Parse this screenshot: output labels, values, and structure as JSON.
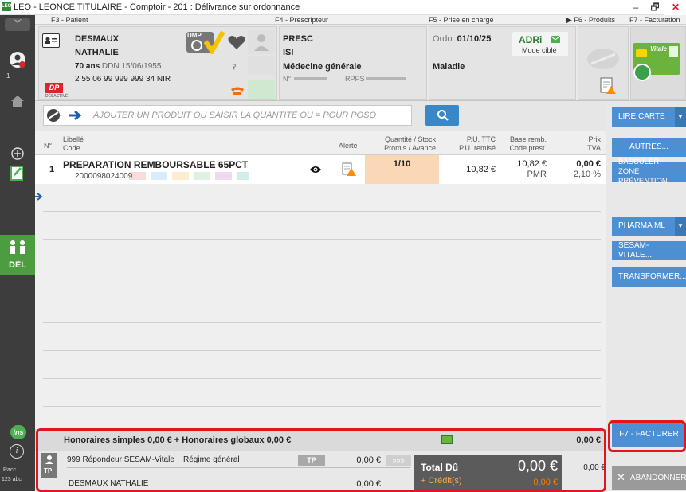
{
  "window": {
    "title": "LEO - LEONCE TITULAIRE - Comptoir - 201 : Délivrance sur ordonnance",
    "logo": "LEO",
    "controls": [
      "–",
      "🗗",
      "✕"
    ]
  },
  "fkeys": {
    "patient": "F3 - Patient",
    "prescripteur": "F4 - Prescripteur",
    "prise_en_charge": "F5 - Prise en charge",
    "produits": "▶ F6 - Produits",
    "facturation": "F7 - Facturation"
  },
  "leftbar": {
    "badge": "1",
    "del_label": "DÉL",
    "ins_label": "ins",
    "racc_label": "Racc.",
    "abc_label": "123 abc"
  },
  "patient": {
    "lastname": "DESMAUX",
    "firstname": "NATHALIE",
    "age": "70 ans",
    "ddn": "DDN 15/06/1955",
    "nir": "2 55 06 99 999 999 34 NIR",
    "gender_symbol": "♀",
    "dmp_label": "DMP",
    "dp_label": "DP",
    "dp_sub": "DÉSACTIVÉ"
  },
  "prescripteur": {
    "line1": "PRESC",
    "line2": "ISI",
    "specialty": "Médecine générale",
    "n_label": "N°",
    "rpps_label": "RPPS"
  },
  "ordonnance": {
    "ordo_label": "Ordo.",
    "ordo_date": "01/10/25",
    "adri_label": "ADRi",
    "mode": "Mode ciblé",
    "nature": "Maladie"
  },
  "vitale": {
    "label": "Vitale"
  },
  "search": {
    "placeholder": "AJOUTER UN PRODUIT OU SAISIR LA QUANTITÉ OU = POUR POSO"
  },
  "table": {
    "headers": {
      "num": "N°",
      "libelle": "Libellé",
      "code": "Code",
      "alerte": "Alerte",
      "qty": "Quantité / Stock",
      "promis": "Promis / Avance",
      "pu": "P.U. TTC",
      "pu_remise": "P.U. remisé",
      "base": "Base remb.",
      "code_prest": "Code prest.",
      "prix": "Prix",
      "tva": "TVA"
    },
    "rows": [
      {
        "num": "1",
        "libelle": "PREPARATION REMBOURSABLE 65PCT",
        "code": "2000098024009",
        "qty": "1/10",
        "pu": "10,82 €",
        "base": "10,82 €",
        "prest": "PMR",
        "prix": "0,00 €",
        "tva": "2,10 %"
      }
    ]
  },
  "rightbar": {
    "lire_carte": "LIRE CARTE",
    "autres": "AUTRES...",
    "basculer": "BASCULER ZONE PRÉVENTION",
    "pharma_ml": "PHARMA ML",
    "sesam": "SESAM-VITALE...",
    "transformer": "TRANSFORMER...",
    "facturer": "F7 - FACTURER",
    "abandonner": "ABANDONNER"
  },
  "bottom": {
    "honoraires": "Honoraires simples 0,00 € + Honoraires globaux 0,00 €",
    "honoraires_total": "0,00 €",
    "organisme": "999 Répondeur SESAM-Vitale",
    "regime": "Régime général",
    "tp_label": "TP",
    "amo_amount": "0,00 €",
    "arrows": "»»»",
    "person_tp": "TP",
    "assure": "DESMAUX NATHALIE",
    "assure_amount": "0,00 €",
    "total_du_label": "Total Dû",
    "total_du": "0,00 €",
    "credit_label": "+ Crédit(s)",
    "credit": "0,00 €",
    "side_amount": "0,00 €"
  }
}
